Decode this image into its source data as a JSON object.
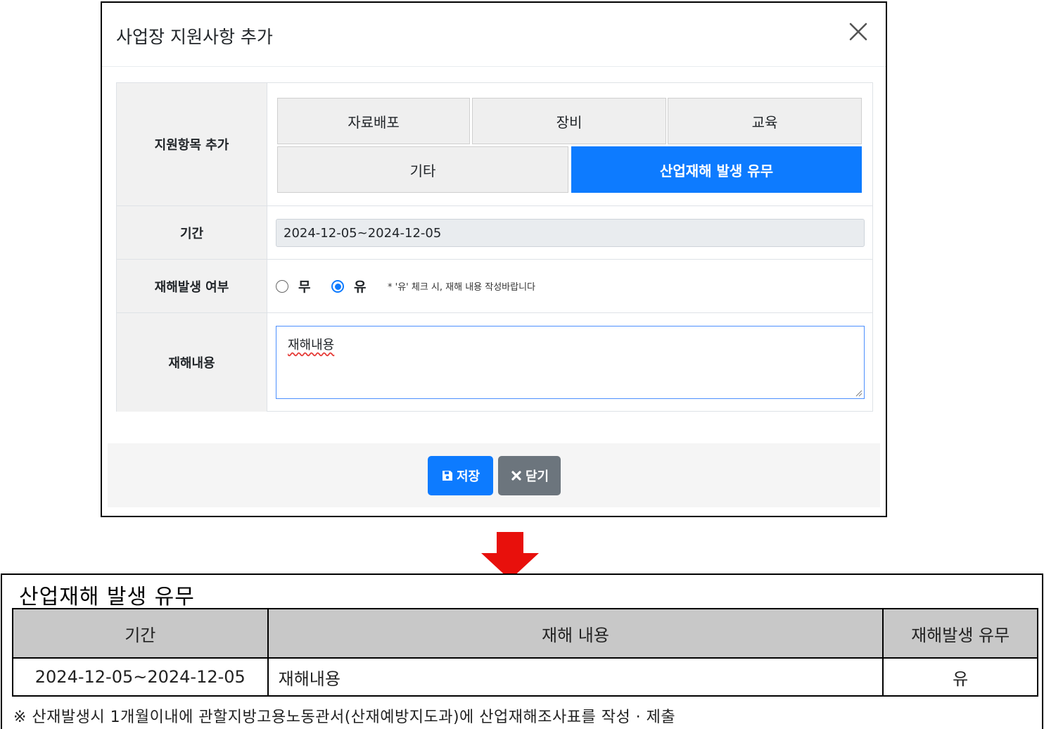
{
  "modal": {
    "title": "사업장 지원사항 추가",
    "close_icon": "close-icon",
    "form": {
      "items_row": {
        "label": "지원항목 추가",
        "buttons": [
          "자료배포",
          "장비",
          "교육",
          "기타",
          "산업재해 발생 유무"
        ],
        "active": "산업재해 발생 유무"
      },
      "period_row": {
        "label": "기간",
        "value": "2024-12-05~2024-12-05"
      },
      "radio_row": {
        "label": "재해발생 여부",
        "options": [
          "무",
          "유"
        ],
        "selected": "유",
        "hint": "* '유' 체크 시, 재해 내용 작성바랍니다"
      },
      "content_row": {
        "label": "재해내용",
        "value": "재해내용"
      }
    },
    "footer": {
      "save_label": "저장",
      "close_label": "닫기",
      "save_icon": "floppy-disk-icon",
      "close_icon": "times-icon"
    }
  },
  "arrow": {
    "color": "#e8100c",
    "icon": "arrow-down-icon"
  },
  "report": {
    "title": "산업재해 발생 유무",
    "headers": [
      "기간",
      "재해 내용",
      "재해발생 유무"
    ],
    "row": {
      "period": "2024-12-05~2024-12-05",
      "content": "재해내용",
      "occurrence": "유"
    },
    "note": "※ 산재발생시 1개월이내에 관할지방고용노동관서(산재예방지도과)에 산업재해조사표를 작성 · 제출"
  },
  "colors": {
    "primary": "#0d7bff",
    "secondary": "#6c757d",
    "label_bg": "#f1f1f1",
    "header_gray": "#c8c8c8"
  }
}
